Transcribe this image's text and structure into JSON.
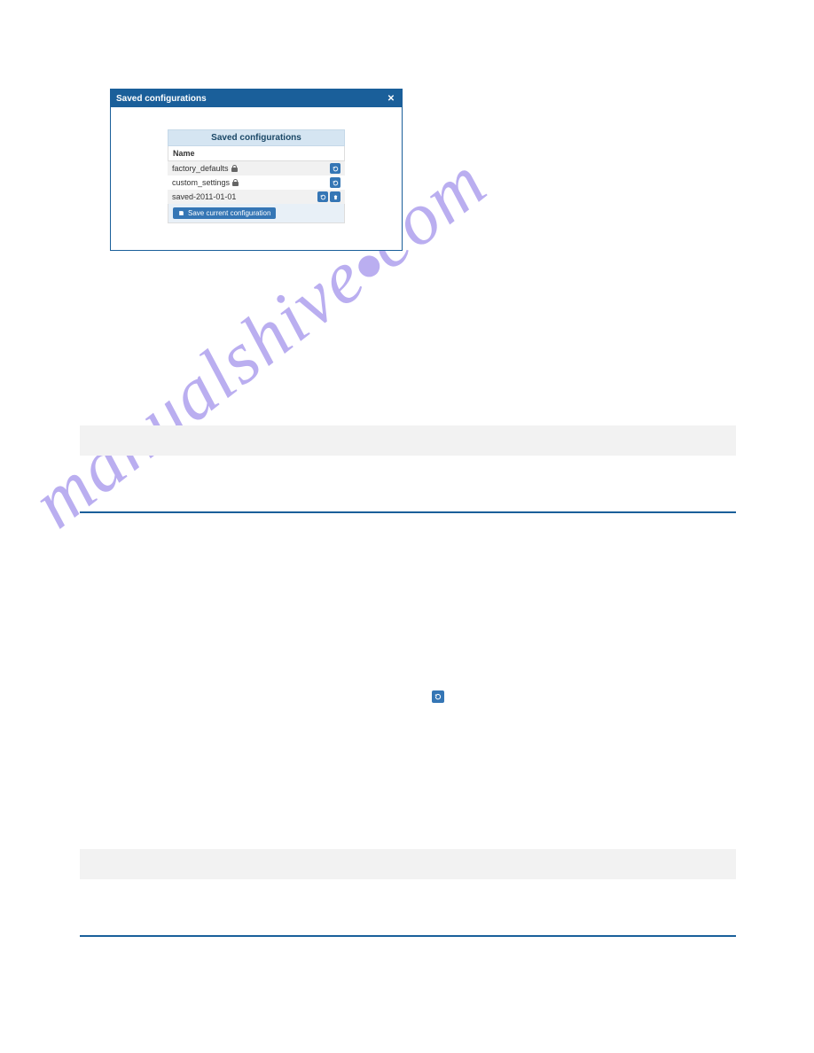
{
  "dialog": {
    "title": "Saved configurations",
    "close_glyph": "✕"
  },
  "table": {
    "header": "Saved configurations",
    "col": "Name",
    "rows": [
      {
        "name": "factory_defaults",
        "locked": true,
        "deletable": false
      },
      {
        "name": "custom_settings",
        "locked": true,
        "deletable": false
      },
      {
        "name": "saved-2011-01-01",
        "locked": false,
        "deletable": true
      }
    ],
    "save_label": "Save current configuration"
  },
  "watermark": {
    "text_a": "manualshive",
    "text_b": "com"
  }
}
